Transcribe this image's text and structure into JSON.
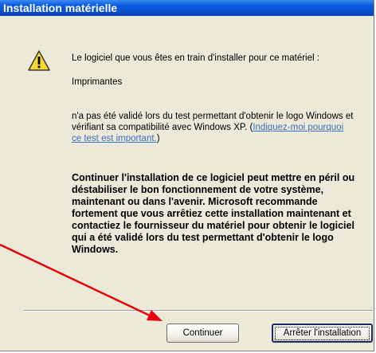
{
  "window": {
    "title": "Installation matérielle"
  },
  "message": {
    "line1": "Le logiciel que vous êtes en train d'installer pour ce matériel :",
    "device": "Imprimantes",
    "line2": "n'a pas été validé lors du test permettant d'obtenir le logo Windows et vérifiant sa compatibilité avec Windows XP. (",
    "link": "Indiquez-moi pourquoi ce test est important.",
    "line2_end": ")"
  },
  "warning": "Continuer l'installation de ce logiciel peut mettre en péril ou déstabiliser le bon fonctionnement de votre système, maintenant ou dans l'avenir. Microsoft recommande fortement que vous arrêtiez cette installation maintenant et contactiez le fournisseur du matériel pour obtenir le logiciel qui a été validé lors du test permettant d'obtenir le logo Windows.",
  "buttons": {
    "continue": "Continuer",
    "stop": "Arrêter l'installation"
  },
  "colors": {
    "title_bar": "#0a5ae0",
    "dialog_bg": "#ece9d8",
    "link": "#3a6fc8",
    "annotation_arrow": "#e8000a"
  },
  "icons": {
    "warning": "warning-triangle-icon"
  }
}
